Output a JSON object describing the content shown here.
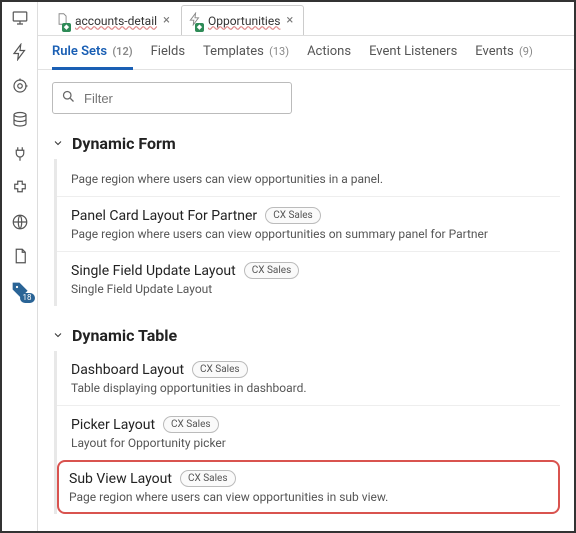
{
  "iconbar": {
    "badge_value": "18"
  },
  "top_tabs": [
    {
      "label": "accounts-detail"
    },
    {
      "label": "Opportunities"
    }
  ],
  "subtabs": [
    {
      "label": "Rule Sets",
      "count": "(12)",
      "active": true
    },
    {
      "label": "Fields",
      "count": "",
      "active": false
    },
    {
      "label": "Templates",
      "count": "(13)",
      "active": false
    },
    {
      "label": "Actions",
      "count": "",
      "active": false
    },
    {
      "label": "Event Listeners",
      "count": "",
      "active": false
    },
    {
      "label": "Events",
      "count": "(9)",
      "active": false
    }
  ],
  "filter": {
    "placeholder": "Filter"
  },
  "sections": {
    "form": {
      "title": "Dynamic Form",
      "items": [
        {
          "name": "",
          "tag": "",
          "desc": "Page region where users can view opportunities in a panel."
        },
        {
          "name": "Panel Card Layout For Partner",
          "tag": "CX Sales",
          "desc": "Page region where users can view opportunities on summary panel for Partner"
        },
        {
          "name": "Single Field Update Layout",
          "tag": "CX Sales",
          "desc": "Single Field Update Layout"
        }
      ]
    },
    "table": {
      "title": "Dynamic Table",
      "items": [
        {
          "name": "Dashboard Layout",
          "tag": "CX Sales",
          "desc": "Table displaying opportunities in dashboard."
        },
        {
          "name": "Picker Layout",
          "tag": "CX Sales",
          "desc": "Layout for Opportunity picker"
        },
        {
          "name": "Sub View Layout",
          "tag": "CX Sales",
          "desc": "Page region where users can view opportunities in sub view."
        }
      ]
    }
  }
}
